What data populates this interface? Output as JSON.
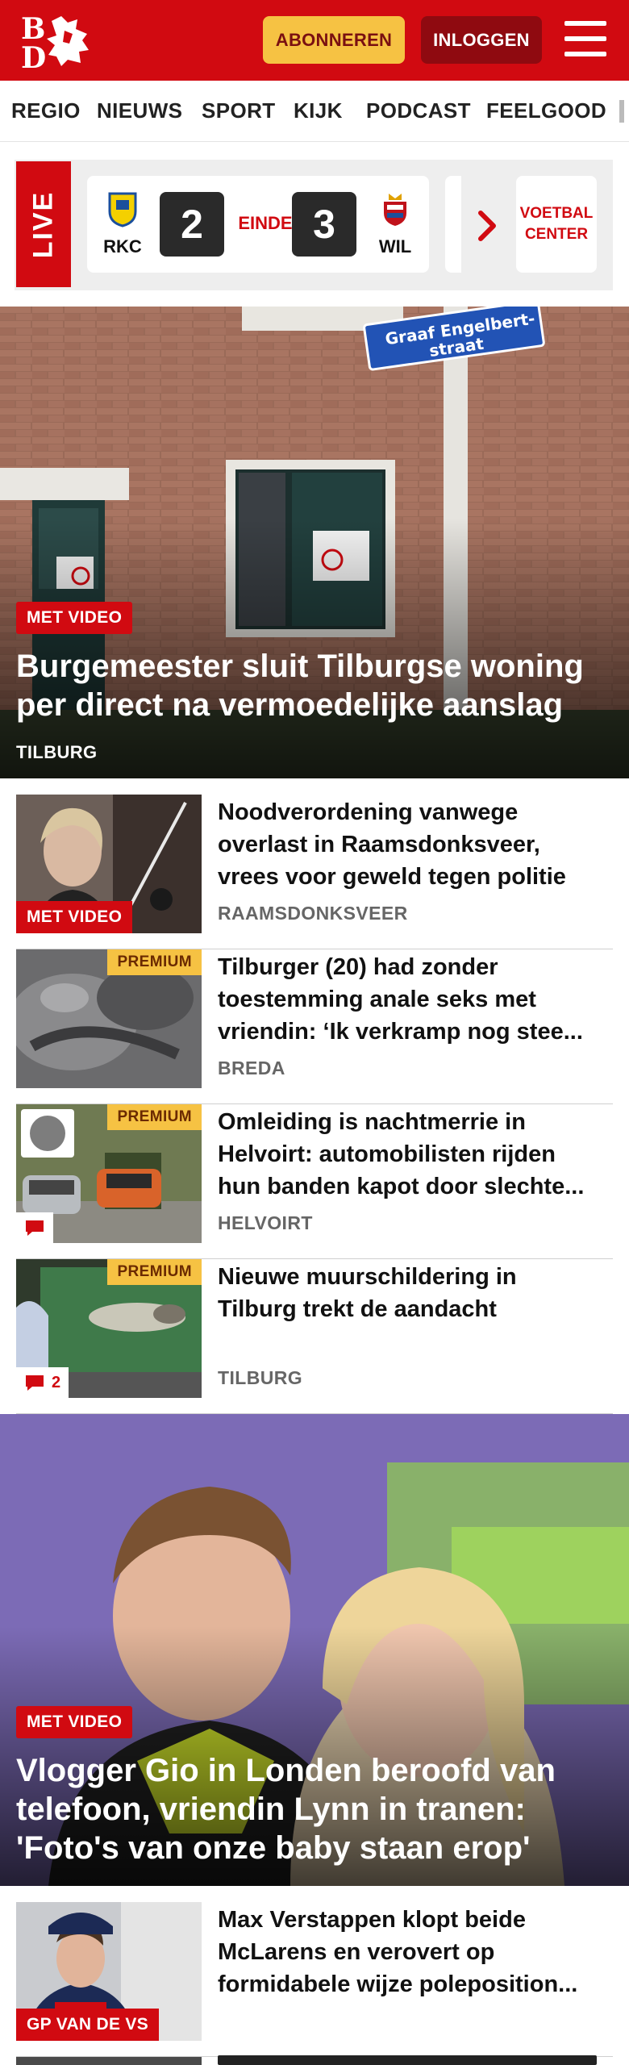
{
  "header": {
    "logo_text": "BD",
    "subscribe_label": "ABONNEREN",
    "login_label": "INLOGGEN"
  },
  "nav": {
    "items": [
      "REGIO",
      "NIEUWS",
      "SPORT",
      "KIJK",
      "PODCAST",
      "FEELGOOD"
    ]
  },
  "live": {
    "label": "LIVE",
    "home_team": "RKC",
    "home_score": "2",
    "status": "EINDE",
    "away_score": "3",
    "away_team": "WIL",
    "voetbal_line1": "VOETBAL",
    "voetbal_line2": "CENTER"
  },
  "lead1": {
    "badge": "MET VIDEO",
    "title": "Burgemeester sluit Tilburgse woning per direct na vermoedelijke aanslag",
    "location": "TILBURG",
    "sign_line1": "Graaf Engelbert-",
    "sign_line2": "straat"
  },
  "items": [
    {
      "title": "Noodverordening vanwege overlast in Raamsdonksveer, vrees voor geweld tegen politie",
      "location": "RAAMSDONKSVEER",
      "badge": "MET VIDEO"
    },
    {
      "title": "Tilburger (20) had zonder toestemming anale seks met vriendin: ‘Ik verkramp nog stee...",
      "location": "BREDA",
      "premium": "PREMIUM"
    },
    {
      "title": "Omleiding is nachtmerrie in Helvoirt: automobilisten rijden hun banden kapot door slechte...",
      "location": "HELVOIRT",
      "premium": "PREMIUM"
    },
    {
      "title": "Nieuwe muurschildering in Tilburg trekt de aandacht",
      "location": "TILBURG",
      "premium": "PREMIUM",
      "comments": "2"
    }
  ],
  "lead2": {
    "badge": "MET VIDEO",
    "title": "Vlogger Gio in Londen beroofd van telefoon, vriendin Lynn in tranen: 'Foto's van onze baby staan erop'"
  },
  "item5": {
    "title": "Max Verstappen klopt beide McLarens en verovert op formidabele wijze poleposition...",
    "badge": "GP VAN DE VS"
  },
  "colors": {
    "brand_red": "#d10a11",
    "premium_yellow": "#f6c243",
    "dark_red": "#8f0a10"
  }
}
